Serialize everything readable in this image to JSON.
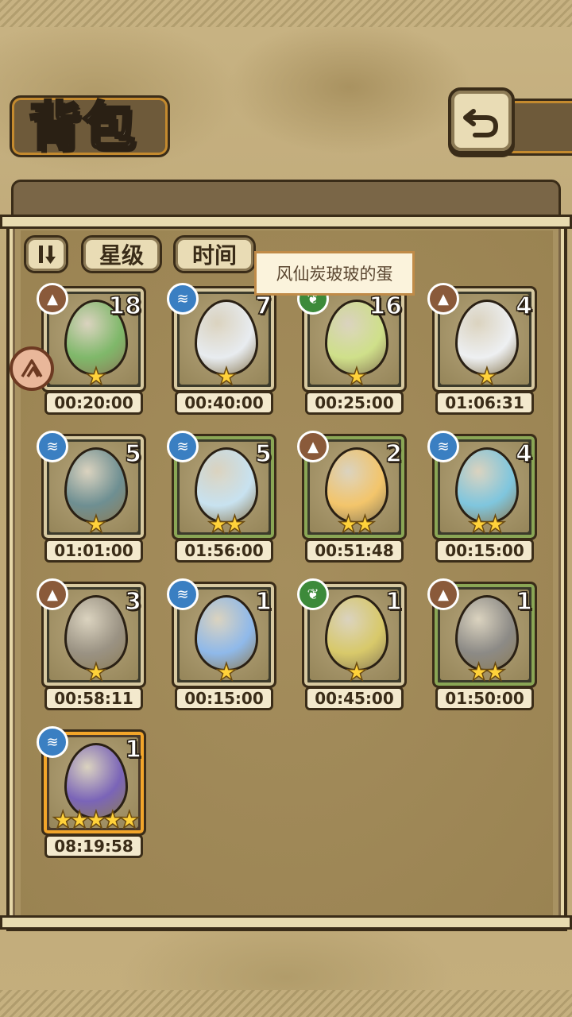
{
  "header": {
    "title": "背包"
  },
  "filters": {
    "star_label": "星级",
    "time_label": "时间"
  },
  "tooltip": {
    "text": "风仙炭玻玻的蛋"
  },
  "items": [
    {
      "count": "18",
      "stars": "★",
      "timer": "00:20:00",
      "element": "earth",
      "frame": "normal",
      "color": "#7fb86a"
    },
    {
      "count": "7",
      "stars": "★",
      "timer": "00:40:00",
      "element": "water",
      "frame": "normal",
      "color": "#e8ecf0"
    },
    {
      "count": "16",
      "stars": "★",
      "timer": "00:25:00",
      "element": "leaf",
      "frame": "normal",
      "color": "#cfe08a"
    },
    {
      "count": "4",
      "stars": "★",
      "timer": "01:06:31",
      "element": "earth",
      "frame": "normal",
      "color": "#eef0f2"
    },
    {
      "count": "5",
      "stars": "★",
      "timer": "01:01:00",
      "element": "water",
      "frame": "normal",
      "color": "#6e8f92"
    },
    {
      "count": "5",
      "stars": "★★",
      "timer": "01:56:00",
      "element": "water",
      "frame": "green",
      "color": "#c8e2f0"
    },
    {
      "count": "2",
      "stars": "★★",
      "timer": "00:51:48",
      "element": "earth",
      "frame": "green",
      "color": "#f3c56b"
    },
    {
      "count": "4",
      "stars": "★★",
      "timer": "00:15:00",
      "element": "water",
      "frame": "green",
      "color": "#7fc6de"
    },
    {
      "count": "3",
      "stars": "★",
      "timer": "00:58:11",
      "element": "earth",
      "frame": "normal",
      "color": "#9a9283"
    },
    {
      "count": "1",
      "stars": "★",
      "timer": "00:15:00",
      "element": "water",
      "frame": "normal",
      "color": "#8fb9ea"
    },
    {
      "count": "1",
      "stars": "★",
      "timer": "00:45:00",
      "element": "leaf",
      "frame": "normal",
      "color": "#d8c96a"
    },
    {
      "count": "1",
      "stars": "★★",
      "timer": "01:50:00",
      "element": "earth",
      "frame": "green",
      "color": "#8c8a86"
    },
    {
      "count": "1",
      "stars": "★★★★★",
      "timer": "08:19:58",
      "element": "water",
      "frame": "gold",
      "color": "#7a64b8"
    }
  ]
}
